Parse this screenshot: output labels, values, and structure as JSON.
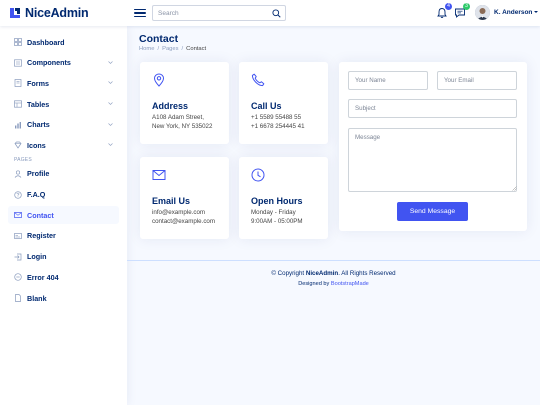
{
  "brand": {
    "name": "NiceAdmin",
    "color": "#012970",
    "accent": "#4154f1"
  },
  "header": {
    "search_placeholder": "Search",
    "notifications_count": "4",
    "messages_count": "3",
    "user_name": "K. Anderson",
    "notifications_icon": "bell-icon",
    "messages_icon": "chat-icon"
  },
  "sidebar": {
    "items": [
      {
        "label": "Dashboard",
        "icon": "grid-icon"
      },
      {
        "label": "Components",
        "icon": "menu-icon"
      },
      {
        "label": "Forms",
        "icon": "journal-icon"
      },
      {
        "label": "Tables",
        "icon": "layout-icon"
      },
      {
        "label": "Charts",
        "icon": "bar-chart-icon"
      },
      {
        "label": "Icons",
        "icon": "gem-icon"
      }
    ],
    "heading": "PAGES",
    "pages": [
      {
        "label": "Profile",
        "icon": "person-icon"
      },
      {
        "label": "F.A.Q",
        "icon": "question-icon"
      },
      {
        "label": "Contact",
        "icon": "envelope-icon",
        "active": true
      },
      {
        "label": "Register",
        "icon": "card-icon"
      },
      {
        "label": "Login",
        "icon": "login-icon"
      },
      {
        "label": "Error 404",
        "icon": "dash-circle-icon"
      },
      {
        "label": "Blank",
        "icon": "file-icon"
      }
    ]
  },
  "page": {
    "title": "Contact",
    "breadcrumb": [
      "Home",
      "Pages",
      "Contact"
    ]
  },
  "cards": {
    "address": {
      "title": "Address",
      "line1": "A108 Adam Street,",
      "line2": "New York, NY 535022"
    },
    "call": {
      "title": "Call Us",
      "line1": "+1 5589 55488 55",
      "line2": "+1 6678 254445 41"
    },
    "email": {
      "title": "Email Us",
      "line1": "info@example.com",
      "line2": "contact@example.com"
    },
    "hours": {
      "title": "Open Hours",
      "line1": "Monday - Friday",
      "line2": "9:00AM - 05:00PM"
    }
  },
  "form": {
    "name_placeholder": "Your Name",
    "email_placeholder": "Your Email",
    "subject_placeholder": "Subject",
    "message_placeholder": "Message",
    "submit_label": "Send Message"
  },
  "footer": {
    "copyright_prefix": "© Copyright ",
    "copyright_brand": "NiceAdmin",
    "copyright_suffix": ". All Rights Reserved",
    "designed_by": "Designed by ",
    "designer": "BootstrapMade"
  }
}
